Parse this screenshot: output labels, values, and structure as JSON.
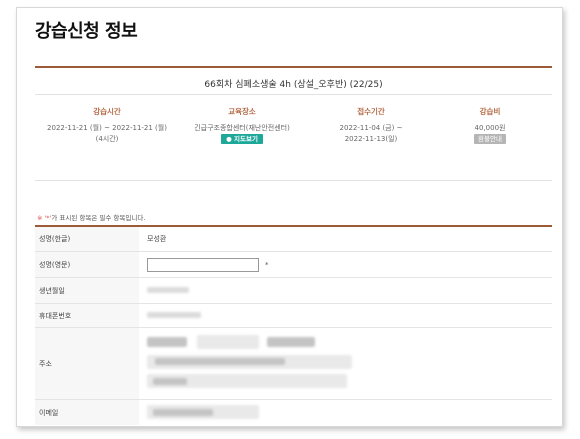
{
  "page": {
    "title": "강습신청 정보"
  },
  "course": {
    "name": "66회차 심폐소생술 4h (상설_오후반) (22/25)"
  },
  "info": {
    "schedule": {
      "label": "강습시간",
      "line1": "2022-11-21 (월) ~ 2022-11-21 (월)",
      "line2": "(4시간)"
    },
    "venue": {
      "label": "교육장소",
      "line1": "긴급구조종합센터(재난안전센터)",
      "map_button": "지도보기"
    },
    "period": {
      "label": "접수기간",
      "line1": "2022-11-04 (금) ~",
      "line2": "2022-11-13(일)"
    },
    "fee": {
      "label": "강습비",
      "amount": "40,000원",
      "badge": "환불안내"
    }
  },
  "form": {
    "notice_star": "※ '*'",
    "notice_text": "가 표시된 항목은 필수 항목입니다.",
    "rows": [
      {
        "label": "성명(한글)",
        "value": "모성환"
      },
      {
        "label": "성명(영문)",
        "required_mark": "*"
      },
      {
        "label": "생년월일"
      },
      {
        "label": "휴대폰번호"
      },
      {
        "label": "주소"
      },
      {
        "label": "이메일"
      }
    ]
  },
  "colors": {
    "accent": "#9c5a37",
    "header_text": "#b56a46",
    "map_button": "#1ea89a",
    "badge": "#b5b5b5"
  }
}
